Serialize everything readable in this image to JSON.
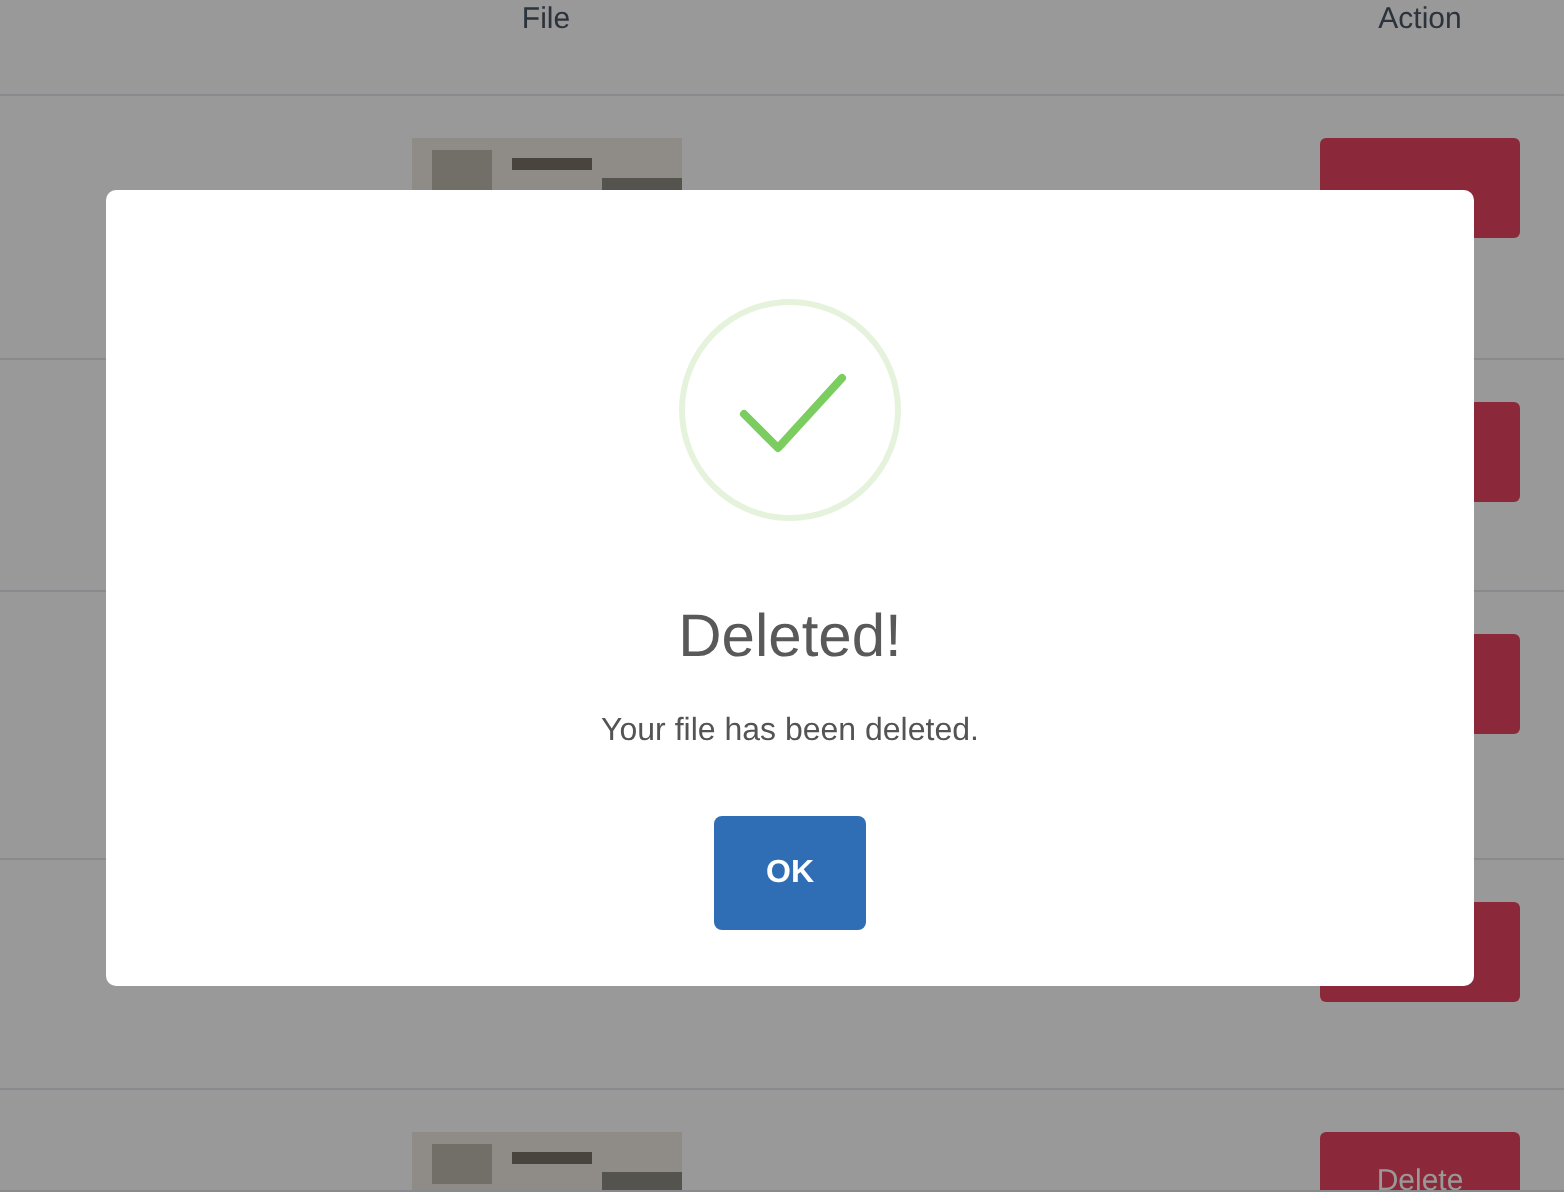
{
  "table": {
    "columns": [
      "File",
      "Action"
    ],
    "rows": [
      {
        "has_thumbnail": true
      },
      {},
      {},
      {
        "has_thumbnail": false
      },
      {
        "has_thumbnail": true,
        "button_label": "Delete"
      }
    ]
  },
  "dialog": {
    "title": "Deleted!",
    "message": "Your file has been deleted.",
    "confirm_button": "OK"
  }
}
